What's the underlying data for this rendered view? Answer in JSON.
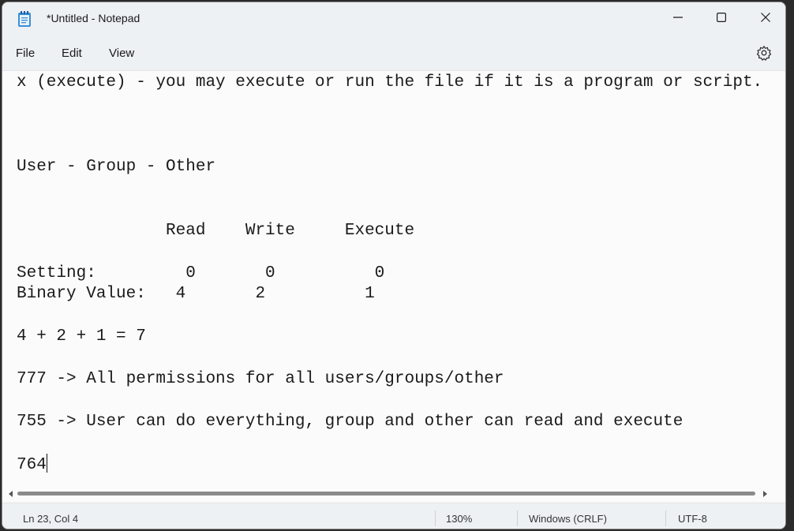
{
  "window": {
    "title": "*Untitled - Notepad",
    "minimize_icon": "minimize-icon",
    "maximize_icon": "maximize-icon",
    "close_icon": "close-icon"
  },
  "menu": {
    "items": [
      "File",
      "Edit",
      "View"
    ],
    "settings_icon": "gear-icon"
  },
  "editor": {
    "lines": [
      "x (execute) - you may execute or run the file if it is a program or script.",
      "",
      "",
      "",
      "User - Group - Other",
      "",
      "",
      "               Read    Write     Execute",
      "",
      "Setting:         0       0          0",
      "Binary Value:   4       2          1",
      "",
      "4 + 2 + 1 = 7",
      "",
      "777 -> All permissions for all users/groups/other",
      "",
      "755 -> User can do everything, group and other can read and execute",
      "",
      "764"
    ]
  },
  "status": {
    "position": "Ln 23, Col 4",
    "zoom": "130%",
    "line_ending": "Windows (CRLF)",
    "encoding": "UTF-8"
  },
  "colors": {
    "chrome_background": "#eef1f4",
    "editor_background": "#fbfbfb",
    "text": "#1a1a1a"
  }
}
